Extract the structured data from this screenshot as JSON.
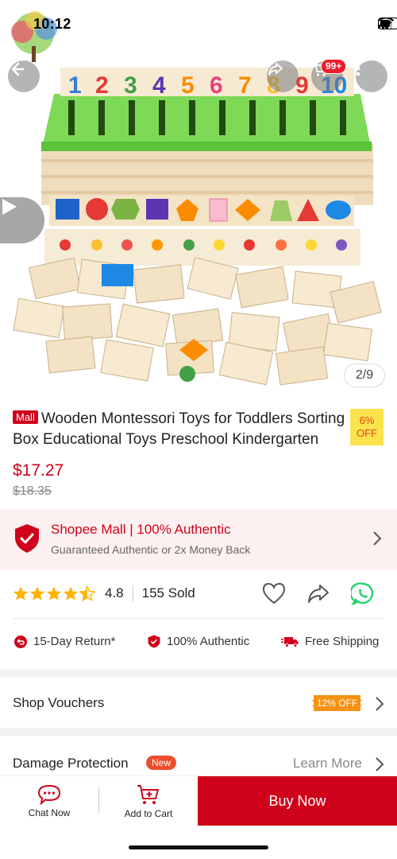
{
  "status_bar": {
    "time": "10:12"
  },
  "header": {
    "cart_badge": "99+"
  },
  "gallery": {
    "indicator": "2/9"
  },
  "product": {
    "mall_tag": "Mall",
    "title": "Wooden Montessori Toys for Toddlers Sorting Box Educational Toys Preschool Kindergarten",
    "discount_pct": "6%",
    "discount_word": "OFF",
    "price": "$17.27",
    "original_price": "$18.35"
  },
  "mall_banner": {
    "title": "Shopee Mall | 100% Authentic",
    "subtitle": "Guaranteed Authentic or 2x Money Back"
  },
  "rating": {
    "value": "4.8",
    "stars_filled": 4.5,
    "sold": "155 Sold"
  },
  "guarantees": {
    "return": "15-Day Return*",
    "authentic": "100% Authentic",
    "shipping": "Free Shipping"
  },
  "vouchers": {
    "label": "Shop Vouchers",
    "tag": "12% OFF"
  },
  "protection": {
    "label": "Damage Protection",
    "new_tag": "New",
    "learn_more": "Learn More"
  },
  "bottom_bar": {
    "chat": "Chat Now",
    "add_to_cart": "Add to Cart",
    "buy_now": "Buy Now"
  },
  "colors": {
    "brand": "#d0011b",
    "accent": "#ee4d2d",
    "star": "#ffb400",
    "whatsapp": "#25d366"
  },
  "icons": [
    "back-icon",
    "share-icon",
    "cart-icon",
    "more-icon",
    "play-icon",
    "shield-check-icon",
    "chevron-right-icon",
    "heart-icon",
    "whatsapp-icon",
    "return-icon",
    "truck-icon",
    "chat-icon"
  ]
}
